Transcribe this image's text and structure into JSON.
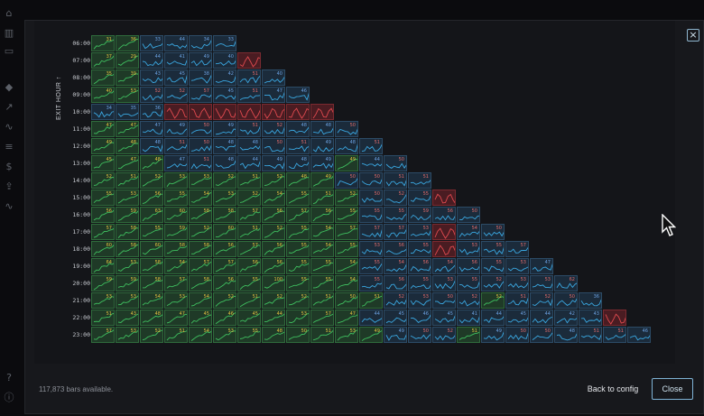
{
  "sidebar": {
    "icons": [
      "home-icon",
      "chart-icon",
      "folder-icon",
      "graduation-icon",
      "trend-icon",
      "activity-icon",
      "database-icon",
      "dollar-icon",
      "upload-icon",
      "pulse-icon",
      "help-icon",
      "info-icon"
    ]
  },
  "modal": {
    "close_glyph": "×",
    "axis_title": "EXIT HOUR ↑",
    "footer_note": "117,873 bars available.",
    "back_label": "Back to config",
    "close_label": "Close"
  },
  "rows": [
    "06:00",
    "07:00",
    "08:00",
    "09:00",
    "10:00",
    "11:00",
    "12:00",
    "13:00",
    "14:00",
    "15:00",
    "16:00",
    "17:00",
    "18:00",
    "19:00",
    "20:00",
    "21:00",
    "22:00",
    "23:00"
  ],
  "colors": {
    "green_bg": "#1f3a27",
    "green_line": "#3fbf5f",
    "green_border": "#2f6b3c",
    "blue_bg": "#1b2b3b",
    "blue_line": "#3aa7e0",
    "blue_border": "#2c4b66",
    "red_bg": "#4a1c22",
    "red_line": "#e04a4f",
    "red_border": "#7a2a30",
    "val_yellow": "#e0c040",
    "val_red": "#e06a6a",
    "val_blue": "#6aa0e0"
  },
  "grid": {
    "row_cells": [
      [
        [
          "g",
          "31"
        ],
        [
          "g",
          "36"
        ],
        [
          "b",
          "33"
        ],
        [
          "b",
          "44"
        ],
        [
          "b",
          "34"
        ],
        [
          "b",
          "33"
        ]
      ],
      [
        [
          "g",
          "37"
        ],
        [
          "g",
          "29"
        ],
        [
          "b",
          "44"
        ],
        [
          "b",
          "41"
        ],
        [
          "b",
          "49"
        ],
        [
          "b",
          "40"
        ],
        [
          "r",
          ""
        ]
      ],
      [
        [
          "g",
          "35"
        ],
        [
          "g",
          "39"
        ],
        [
          "b",
          "43"
        ],
        [
          "b",
          "45"
        ],
        [
          "b",
          "38"
        ],
        [
          "b",
          "42"
        ],
        [
          "b",
          "51"
        ],
        [
          "b",
          "40"
        ]
      ],
      [
        [
          "g",
          "40"
        ],
        [
          "g",
          "53"
        ],
        [
          "b",
          "52"
        ],
        [
          "b",
          "52"
        ],
        [
          "b",
          "57"
        ],
        [
          "b",
          "45"
        ],
        [
          "b",
          "51"
        ],
        [
          "b",
          "47"
        ],
        [
          "b",
          "46"
        ]
      ],
      [
        [
          "b",
          "34"
        ],
        [
          "b",
          "35"
        ],
        [
          "b",
          "36"
        ],
        [
          "r",
          ""
        ],
        [
          "r",
          ""
        ],
        [
          "r",
          ""
        ],
        [
          "r",
          ""
        ],
        [
          "r",
          ""
        ],
        [
          "r",
          ""
        ],
        [
          "r",
          ""
        ]
      ],
      [
        [
          "g",
          "47"
        ],
        [
          "g",
          "47"
        ],
        [
          "b",
          "47"
        ],
        [
          "b",
          "49"
        ],
        [
          "b",
          "50"
        ],
        [
          "b",
          "49"
        ],
        [
          "b",
          "51"
        ],
        [
          "b",
          "52"
        ],
        [
          "b",
          "48"
        ],
        [
          "b",
          "48"
        ],
        [
          "b",
          "50"
        ]
      ],
      [
        [
          "g",
          "49"
        ],
        [
          "g",
          "48"
        ],
        [
          "b",
          "48"
        ],
        [
          "b",
          "51"
        ],
        [
          "b",
          "50"
        ],
        [
          "b",
          "48"
        ],
        [
          "b",
          "48"
        ],
        [
          "b",
          "50"
        ],
        [
          "b",
          "51"
        ],
        [
          "b",
          "49"
        ],
        [
          "b",
          "48"
        ],
        [
          "b",
          "51"
        ]
      ],
      [
        [
          "g",
          "45"
        ],
        [
          "g",
          "47"
        ],
        [
          "g",
          "48"
        ],
        [
          "b",
          "47"
        ],
        [
          "b",
          "51"
        ],
        [
          "b",
          "48"
        ],
        [
          "b",
          "44"
        ],
        [
          "b",
          "49"
        ],
        [
          "b",
          "48"
        ],
        [
          "b",
          "49"
        ],
        [
          "g",
          "49"
        ],
        [
          "b",
          "44"
        ],
        [
          "b",
          "50"
        ]
      ],
      [
        [
          "g",
          "52"
        ],
        [
          "g",
          "51"
        ],
        [
          "g",
          "52"
        ],
        [
          "g",
          "53"
        ],
        [
          "g",
          "53"
        ],
        [
          "g",
          "52"
        ],
        [
          "g",
          "51"
        ],
        [
          "g",
          "52"
        ],
        [
          "g",
          "48"
        ],
        [
          "g",
          "49"
        ],
        [
          "b",
          "50"
        ],
        [
          "b",
          "50"
        ],
        [
          "b",
          "51"
        ],
        [
          "b",
          "51"
        ]
      ],
      [
        [
          "g",
          "55"
        ],
        [
          "g",
          "53"
        ],
        [
          "g",
          "56"
        ],
        [
          "g",
          "55"
        ],
        [
          "g",
          "54"
        ],
        [
          "g",
          "53"
        ],
        [
          "g",
          "52"
        ],
        [
          "g",
          "54"
        ],
        [
          "g",
          "55"
        ],
        [
          "g",
          "51"
        ],
        [
          "g",
          "52"
        ],
        [
          "b",
          "50"
        ],
        [
          "b",
          "52"
        ],
        [
          "b",
          "55"
        ],
        [
          "r",
          ""
        ]
      ],
      [
        [
          "g",
          "56"
        ],
        [
          "g",
          "59"
        ],
        [
          "g",
          "63"
        ],
        [
          "g",
          "60"
        ],
        [
          "g",
          "58"
        ],
        [
          "g",
          "58"
        ],
        [
          "g",
          "57"
        ],
        [
          "g",
          "56"
        ],
        [
          "g",
          "57"
        ],
        [
          "g",
          "56"
        ],
        [
          "g",
          "55"
        ],
        [
          "b",
          "55"
        ],
        [
          "b",
          "55"
        ],
        [
          "b",
          "59"
        ],
        [
          "b",
          "56"
        ],
        [
          "b",
          "50"
        ]
      ],
      [
        [
          "g",
          "57"
        ],
        [
          "g",
          "58"
        ],
        [
          "g",
          "55"
        ],
        [
          "g",
          "59"
        ],
        [
          "g",
          "52"
        ],
        [
          "g",
          "60"
        ],
        [
          "g",
          "51"
        ],
        [
          "g",
          "52"
        ],
        [
          "g",
          "55"
        ],
        [
          "g",
          "54"
        ],
        [
          "g",
          "57"
        ],
        [
          "b",
          "57"
        ],
        [
          "b",
          "57"
        ],
        [
          "b",
          "53"
        ],
        [
          "r",
          ""
        ],
        [
          "b",
          "54"
        ],
        [
          "b",
          "50"
        ]
      ],
      [
        [
          "g",
          "60"
        ],
        [
          "g",
          "58"
        ],
        [
          "g",
          "60"
        ],
        [
          "g",
          "58"
        ],
        [
          "g",
          "58"
        ],
        [
          "g",
          "56"
        ],
        [
          "g",
          "57"
        ],
        [
          "g",
          "56"
        ],
        [
          "g",
          "55"
        ],
        [
          "g",
          "54"
        ],
        [
          "g",
          "55"
        ],
        [
          "b",
          "53"
        ],
        [
          "b",
          "56"
        ],
        [
          "b",
          "55"
        ],
        [
          "r",
          ""
        ],
        [
          "b",
          "53"
        ],
        [
          "b",
          "55"
        ],
        [
          "b",
          "57"
        ]
      ],
      [
        [
          "g",
          "64"
        ],
        [
          "g",
          "53"
        ],
        [
          "g",
          "58"
        ],
        [
          "g",
          "54"
        ],
        [
          "g",
          "57"
        ],
        [
          "g",
          "57"
        ],
        [
          "g",
          "56"
        ],
        [
          "g",
          "56"
        ],
        [
          "g",
          "55"
        ],
        [
          "g",
          "55"
        ],
        [
          "g",
          "54"
        ],
        [
          "b",
          "55"
        ],
        [
          "b",
          "54"
        ],
        [
          "b",
          "56"
        ],
        [
          "b",
          "54"
        ],
        [
          "b",
          "56"
        ],
        [
          "b",
          "55"
        ],
        [
          "b",
          "53"
        ],
        [
          "b",
          "47"
        ]
      ],
      [
        [
          "g",
          "59"
        ],
        [
          "g",
          "59"
        ],
        [
          "g",
          "58"
        ],
        [
          "g",
          "57"
        ],
        [
          "g",
          "58"
        ],
        [
          "g",
          "56"
        ],
        [
          "g",
          "55"
        ],
        [
          "g",
          "100"
        ],
        [
          "g",
          "55"
        ],
        [
          "g",
          "55"
        ],
        [
          "g",
          "54"
        ],
        [
          "b",
          "55"
        ],
        [
          "b",
          "56"
        ],
        [
          "b",
          "55"
        ],
        [
          "b",
          "53"
        ],
        [
          "b",
          "55"
        ],
        [
          "b",
          "52"
        ],
        [
          "b",
          "53"
        ],
        [
          "b",
          "53"
        ],
        [
          "b",
          "62"
        ]
      ],
      [
        [
          "g",
          "53"
        ],
        [
          "g",
          "53"
        ],
        [
          "g",
          "54"
        ],
        [
          "g",
          "53"
        ],
        [
          "g",
          "54"
        ],
        [
          "g",
          "52"
        ],
        [
          "g",
          "51"
        ],
        [
          "g",
          "52"
        ],
        [
          "g",
          "52"
        ],
        [
          "g",
          "51"
        ],
        [
          "g",
          "50"
        ],
        [
          "g",
          "51"
        ],
        [
          "b",
          "52"
        ],
        [
          "b",
          "53"
        ],
        [
          "b",
          "50"
        ],
        [
          "b",
          "52"
        ],
        [
          "g",
          "52"
        ],
        [
          "b",
          "51"
        ],
        [
          "b",
          "52"
        ],
        [
          "b",
          "50"
        ],
        [
          "b",
          "36"
        ]
      ],
      [
        [
          "g",
          "51"
        ],
        [
          "g",
          "43"
        ],
        [
          "g",
          "48"
        ],
        [
          "g",
          "47"
        ],
        [
          "g",
          "45"
        ],
        [
          "g",
          "46"
        ],
        [
          "g",
          "45"
        ],
        [
          "g",
          "44"
        ],
        [
          "g",
          "53"
        ],
        [
          "g",
          "57"
        ],
        [
          "g",
          "47"
        ],
        [
          "b",
          "44"
        ],
        [
          "b",
          "45"
        ],
        [
          "b",
          "46"
        ],
        [
          "b",
          "45"
        ],
        [
          "b",
          "41"
        ],
        [
          "b",
          "44"
        ],
        [
          "b",
          "45"
        ],
        [
          "b",
          "44"
        ],
        [
          "b",
          "42"
        ],
        [
          "b",
          "43"
        ],
        [
          "r",
          ""
        ]
      ],
      [
        [
          "g",
          "57"
        ],
        [
          "g",
          "53"
        ],
        [
          "g",
          "52"
        ],
        [
          "g",
          "51"
        ],
        [
          "g",
          "54"
        ],
        [
          "g",
          "53"
        ],
        [
          "g",
          "55"
        ],
        [
          "g",
          "48"
        ],
        [
          "g",
          "50"
        ],
        [
          "g",
          "51"
        ],
        [
          "g",
          "53"
        ],
        [
          "g",
          "49"
        ],
        [
          "b",
          "49"
        ],
        [
          "b",
          "50"
        ],
        [
          "b",
          "52"
        ],
        [
          "g",
          "51"
        ],
        [
          "b",
          "49"
        ],
        [
          "b",
          "50"
        ],
        [
          "b",
          "50"
        ],
        [
          "b",
          "48"
        ],
        [
          "b",
          "51"
        ],
        [
          "b",
          "51"
        ],
        [
          "b",
          "46"
        ]
      ]
    ]
  }
}
